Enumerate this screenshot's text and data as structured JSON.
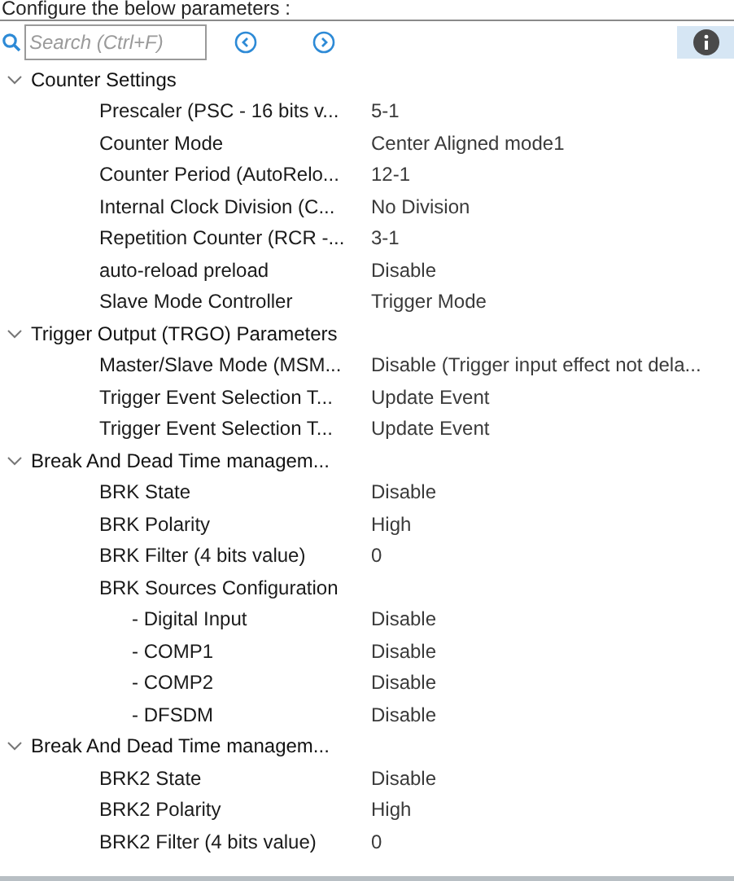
{
  "header": "Configure the below parameters :",
  "search": {
    "placeholder": "Search (Ctrl+F)"
  },
  "groups": [
    {
      "title": "Counter Settings",
      "expanded": true,
      "children": [
        {
          "label": "Prescaler (PSC - 16 bits v...",
          "value": "5-1"
        },
        {
          "label": "Counter Mode",
          "value": "Center Aligned mode1"
        },
        {
          "label": "Counter Period (AutoRelo...",
          "value": "12-1"
        },
        {
          "label": "Internal Clock Division (C...",
          "value": "No Division"
        },
        {
          "label": "Repetition Counter (RCR -...",
          "value": "3-1"
        },
        {
          "label": "auto-reload preload",
          "value": "Disable"
        },
        {
          "label": "Slave Mode Controller",
          "value": "Trigger Mode"
        }
      ]
    },
    {
      "title": "Trigger Output (TRGO) Parameters",
      "expanded": true,
      "children": [
        {
          "label": "Master/Slave Mode (MSM...",
          "value": "Disable (Trigger input effect not dela..."
        },
        {
          "label": "Trigger Event Selection T...",
          "value": "Update Event"
        },
        {
          "label": "Trigger Event Selection T...",
          "value": "Update Event"
        }
      ]
    },
    {
      "title": "Break And Dead Time managem...",
      "expanded": true,
      "children": [
        {
          "label": "BRK State",
          "value": "Disable"
        },
        {
          "label": "BRK Polarity",
          "value": "High"
        },
        {
          "label": "BRK Filter (4 bits value)",
          "value": "0"
        },
        {
          "label": "BRK Sources Configuration",
          "children": [
            {
              "label": "- Digital Input",
              "value": "Disable"
            },
            {
              "label": "- COMP1",
              "value": "Disable"
            },
            {
              "label": "- COMP2",
              "value": "Disable"
            },
            {
              "label": "- DFSDM",
              "value": "Disable"
            }
          ]
        }
      ]
    },
    {
      "title": "Break And Dead Time managem...",
      "expanded": true,
      "children": [
        {
          "label": "BRK2 State",
          "value": "Disable"
        },
        {
          "label": "BRK2 Polarity",
          "value": "High"
        },
        {
          "label": "BRK2 Filter (4 bits value)",
          "value": "0"
        }
      ]
    }
  ]
}
